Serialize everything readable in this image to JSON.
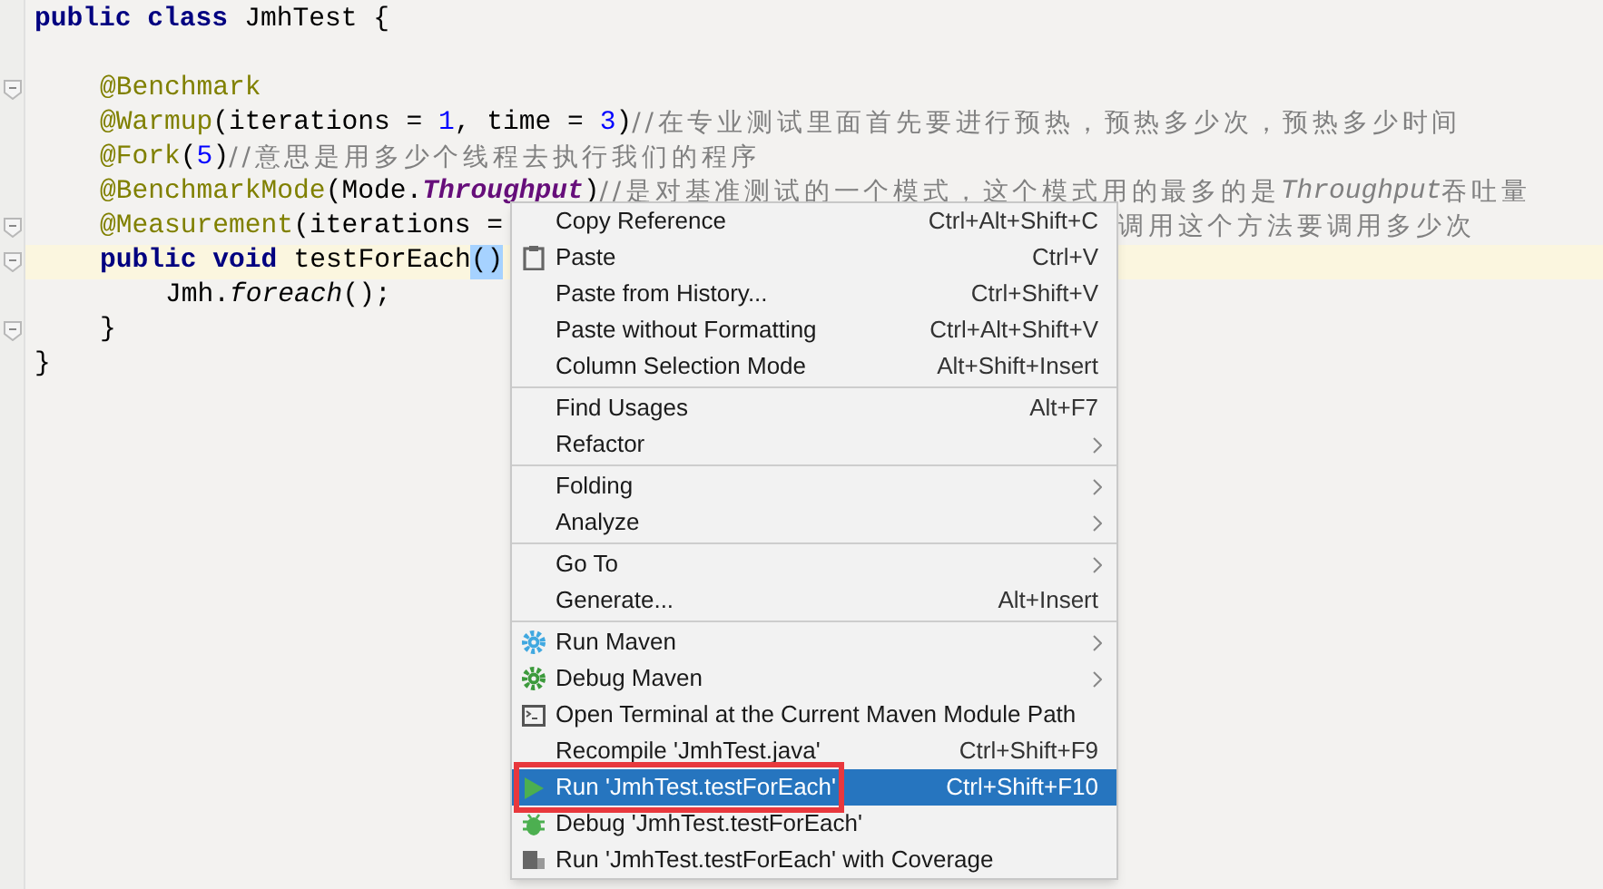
{
  "editor": {
    "lines": [
      {
        "kind": "code",
        "current": false,
        "tokens": [
          {
            "kind": "keyword",
            "text": "public class"
          },
          {
            "kind": "plain",
            "text": "JmhTest {"
          }
        ],
        "children": [
          {
            "kind": "blank",
            "current": false
          },
          {
            "kind": "code",
            "current": false,
            "tokens": [
              {
                "kind": "annotation",
                "text": "@Benchmark"
              }
            ]
          },
          {
            "kind": "code",
            "current": false,
            "tokens": [
              {
                "kind": "annotation",
                "text": "@Warmup"
              },
              {
                "kind": "plain",
                "text": "(iterations = "
              },
              {
                "kind": "number",
                "text": "1"
              },
              {
                "kind": "plain",
                "text": ", time = "
              },
              {
                "kind": "number",
                "text": "3"
              },
              {
                "kind": "plain",
                "text": ")"
              },
              {
                "kind": "comment",
                "text": "//在专业测试里面首先要进行预热，预热多少次，预热多少时间"
              }
            ]
          },
          {
            "kind": "code",
            "current": false,
            "tokens": [
              {
                "kind": "annotation",
                "text": "@Fork"
              },
              {
                "kind": "plain",
                "text": "("
              },
              {
                "kind": "number",
                "text": "5"
              },
              {
                "kind": "plain",
                "text": ")"
              },
              {
                "kind": "comment",
                "text": "//意思是用多少个线程去执行我们的程序"
              }
            ]
          },
          {
            "kind": "code",
            "current": false,
            "tokens": [
              {
                "kind": "annotation",
                "text": "@BenchmarkMode"
              },
              {
                "kind": "plain",
                "text": "(Mode."
              },
              {
                "kind": "constant",
                "text": "Throughput"
              },
              {
                "kind": "plain",
                "text": ")"
              },
              {
                "kind": "comment",
                "text": "//是对基准测试的一个模式，这个模式用的最多的是"
              },
              {
                "kind": "comment_italic",
                "text": "Throughput"
              },
              {
                "kind": "comment",
                "text": "吞吐量"
              }
            ]
          },
          {
            "kind": "code",
            "current": false,
            "tokens": [
              {
                "kind": "annotation",
                "text": "@Measurement"
              },
              {
                "kind": "plain",
                "text": "(iterations ="
              },
              {
                "kind": "comment_after_menu",
                "text": "调用这个方法要调用多少次"
              }
            ]
          },
          {
            "kind": "code",
            "current": true,
            "tokens": [
              {
                "kind": "keyword",
                "text": "public void"
              },
              {
                "kind": "plain",
                "text": "testForEach"
              },
              {
                "kind": "selection",
                "text": "()"
              }
            ],
            "children": [
              {
                "kind": "code",
                "current": false,
                "tokens": [
                  {
                    "kind": "plain",
                    "text": "Jmh."
                  },
                  {
                    "kind": "method",
                    "text": "foreach"
                  },
                  {
                    "kind": "plain",
                    "text": "();"
                  }
                ]
              }
            ]
          },
          {
            "kind": "code",
            "current": false,
            "tokens": [
              {
                "kind": "plain",
                "text": "}"
              }
            ]
          }
        ]
      },
      {
        "kind": "code",
        "current": false,
        "tokens": [
          {
            "kind": "plain",
            "text": "}"
          }
        ]
      }
    ]
  },
  "context_menu": {
    "groups": [
      [
        {
          "kind": "plain",
          "label": "Copy Reference",
          "shortcut": "Ctrl+Alt+Shift+C",
          "submenu": false,
          "selected": false
        },
        {
          "kind": "clipboard",
          "label": "Paste",
          "shortcut": "Ctrl+V",
          "submenu": false,
          "selected": false
        },
        {
          "kind": "plain",
          "label": "Paste from History...",
          "shortcut": "Ctrl+Shift+V",
          "submenu": false,
          "selected": false
        },
        {
          "kind": "plain",
          "label": "Paste without Formatting",
          "shortcut": "Ctrl+Alt+Shift+V",
          "submenu": false,
          "selected": false
        },
        {
          "kind": "plain",
          "label": "Column Selection Mode",
          "shortcut": "Alt+Shift+Insert",
          "submenu": false,
          "selected": false
        }
      ],
      [
        {
          "kind": "plain",
          "label": "Find Usages",
          "shortcut": "Alt+F7",
          "submenu": false,
          "selected": false
        },
        {
          "kind": "plain",
          "label": "Refactor",
          "submenu": true,
          "selected": false
        }
      ],
      [
        {
          "kind": "plain",
          "label": "Folding",
          "submenu": true,
          "selected": false
        },
        {
          "kind": "plain",
          "label": "Analyze",
          "submenu": true,
          "selected": false
        }
      ],
      [
        {
          "kind": "plain",
          "label": "Go To",
          "submenu": true,
          "selected": false
        },
        {
          "kind": "plain",
          "label": "Generate...",
          "shortcut": "Alt+Insert",
          "submenu": false,
          "selected": false
        }
      ],
      [
        {
          "kind": "maven_run",
          "label": "Run Maven",
          "submenu": true,
          "selected": false
        },
        {
          "kind": "maven_debug",
          "label": "Debug Maven",
          "submenu": true,
          "selected": false
        },
        {
          "kind": "terminal",
          "label": "Open Terminal at the Current Maven Module Path",
          "submenu": false,
          "selected": false
        },
        {
          "kind": "plain",
          "label": "Recompile 'JmhTest.java'",
          "shortcut": "Ctrl+Shift+F9",
          "submenu": false,
          "selected": false
        },
        {
          "kind": "run",
          "label": "Run 'JmhTest.testForEach'",
          "shortcut": "Ctrl+Shift+F10",
          "submenu": false,
          "selected": true,
          "highlighted": true
        },
        {
          "kind": "debug",
          "label": "Debug 'JmhTest.testForEach'",
          "submenu": false,
          "selected": false,
          "highlighted": false
        },
        {
          "kind": "coverage",
          "label": "Run 'JmhTest.testForEach' with Coverage",
          "submenu": false,
          "selected": false,
          "highlighted": false
        }
      ]
    ]
  }
}
